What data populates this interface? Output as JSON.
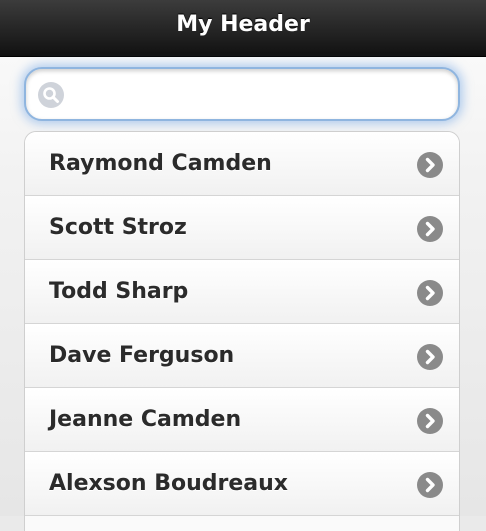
{
  "header": {
    "title": "My Header"
  },
  "search": {
    "value": "",
    "icon": "search-icon"
  },
  "list": {
    "items": [
      {
        "label": "Raymond Camden"
      },
      {
        "label": "Scott Stroz"
      },
      {
        "label": "Todd Sharp"
      },
      {
        "label": "Dave Ferguson"
      },
      {
        "label": "Jeanne Camden"
      },
      {
        "label": "Alexson Boudreaux"
      }
    ],
    "item_icon": "chevron-right-icon"
  },
  "colors": {
    "header_bg": "#1a1a1a",
    "header_text": "#ffffff",
    "search_focus_glow": "#8fb5df",
    "chevron_bg": "#8a8a8a"
  }
}
